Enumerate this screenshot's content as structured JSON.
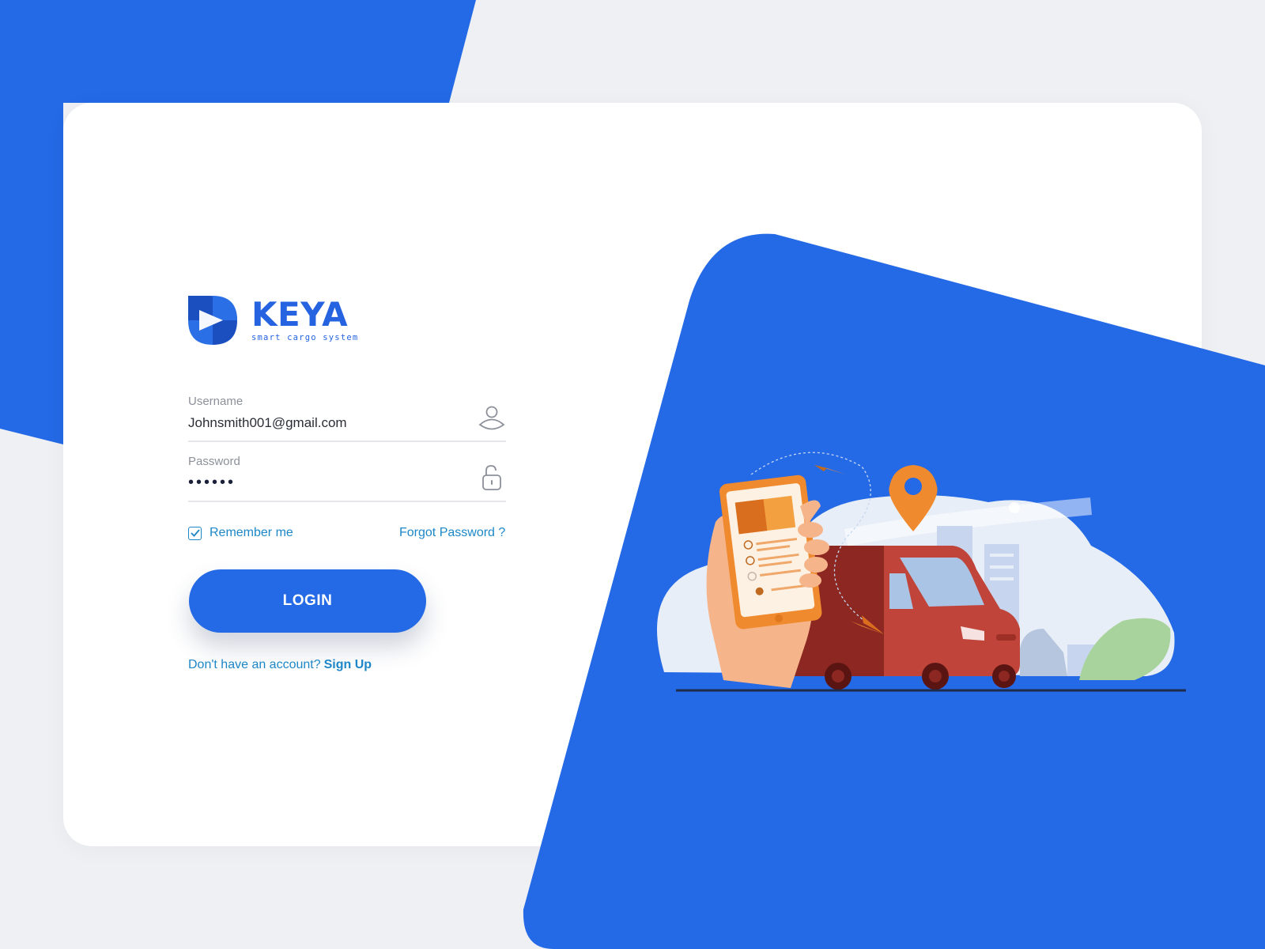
{
  "brand": {
    "name": "KEYA",
    "tagline": "smart cargo system",
    "logo_icon": "keya-logo-icon",
    "accent_color": "#2469e5"
  },
  "form": {
    "username": {
      "label": "Username",
      "value": "Johnsmith001@gmail.com",
      "icon": "user-icon"
    },
    "password": {
      "label": "Password",
      "value": "••••••",
      "icon": "unlock-icon"
    },
    "remember_me": {
      "label": "Remember me",
      "checked": true
    },
    "forgot_password_label": "Forgot Password ?",
    "login_label": "LOGIN",
    "signup_prompt": "Don't have an account?",
    "signup_label": "Sign Up"
  },
  "colors": {
    "link": "#1d87c7",
    "background": "#eef0f3",
    "card": "#ffffff"
  }
}
